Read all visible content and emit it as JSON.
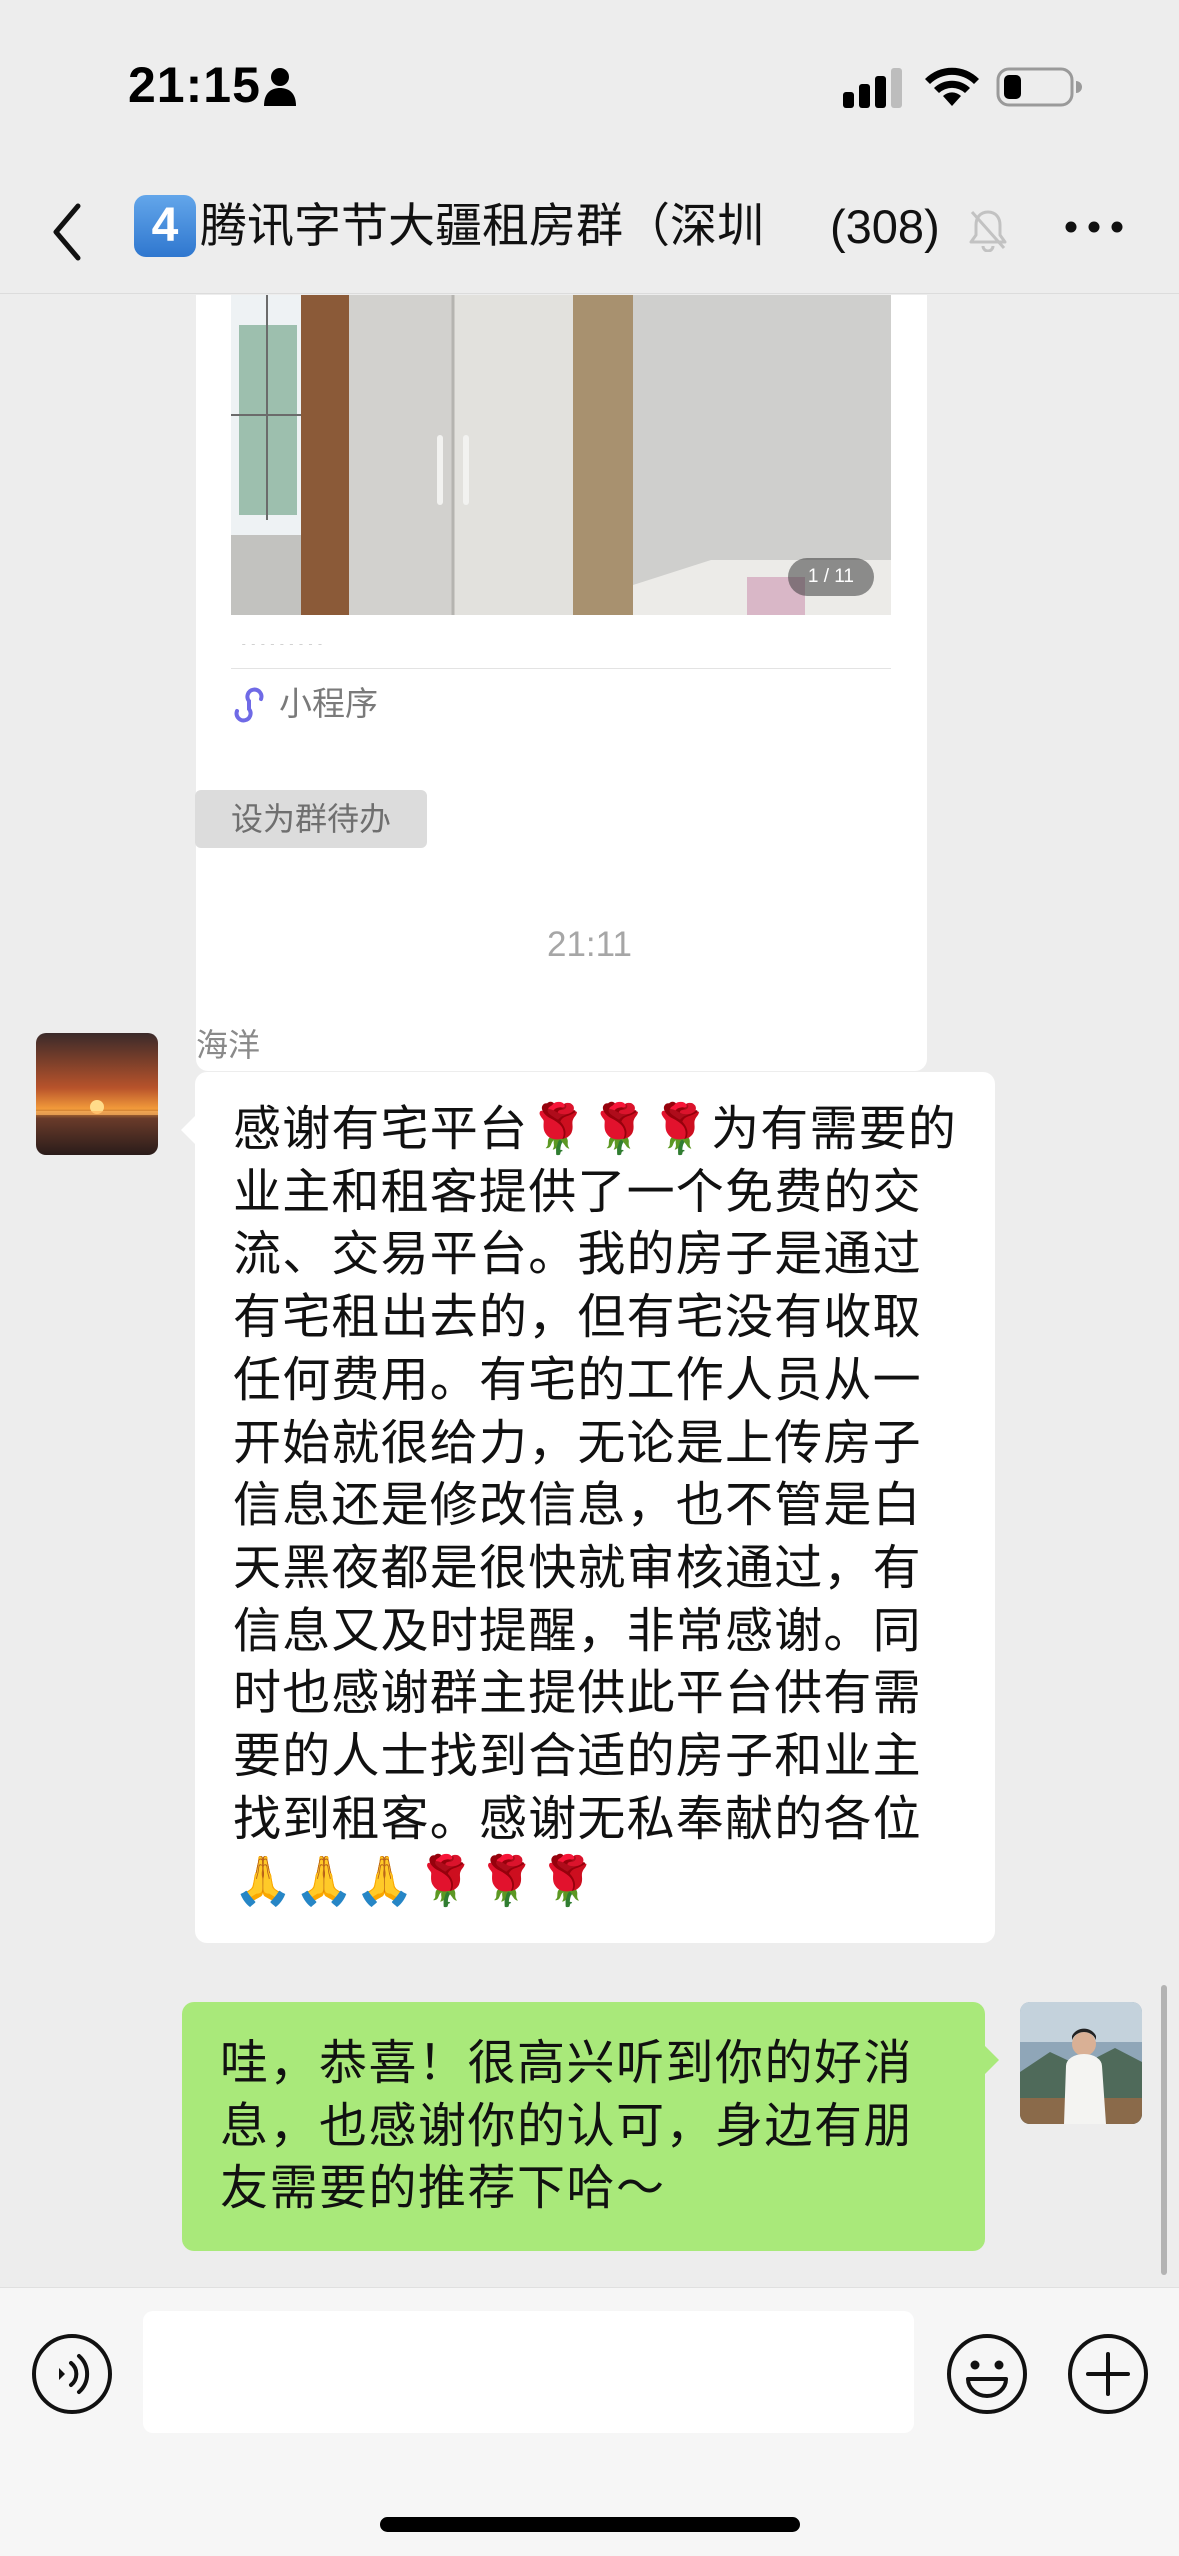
{
  "status_bar": {
    "time": "21:15",
    "icons": [
      "person-icon",
      "signal-icon",
      "wifi-icon",
      "battery-icon"
    ]
  },
  "nav": {
    "badge": "4",
    "group_name": "腾讯字节大疆租房群（深圳",
    "member_count": "(308)",
    "icons": [
      "back-icon",
      "mute-icon",
      "more-icon"
    ]
  },
  "mini_program_card": {
    "photo_counter": "1 / 11",
    "label": "小程序",
    "icon": "mini-program-icon"
  },
  "todo_tag": "设为群待办",
  "time_divider": "21:11",
  "incoming": {
    "sender": "海洋",
    "text": "感谢有宅平台🌹🌹🌹为有需要的业主和租客提供了一个免费的交流、交易平台。我的房子是通过有宅租出去的，但有宅没有收取任何费用。有宅的工作人员从一开始就很给力，无论是上传房子信息还是修改信息，也不管是白天黑夜都是很快就审核通过，有信息又及时提醒，非常感谢。同时也感谢群主提供此平台供有需要的人士找到合适的房子和业主找到租客。感谢无私奉献的各位🙏🙏🙏🌹🌹🌹"
  },
  "outgoing": {
    "text": "哇，恭喜！很高兴听到你的好消息，也感谢你的认可，身边有朋友需要的推荐下哈～"
  },
  "input_bar": {
    "value": "",
    "icons": [
      "voice-icon",
      "emoji-icon",
      "plus-icon"
    ]
  },
  "colors": {
    "background": "#ededed",
    "outgoing_bubble": "#a9e97a",
    "incoming_bubble": "#ffffff",
    "badge": "#3b84d8"
  }
}
